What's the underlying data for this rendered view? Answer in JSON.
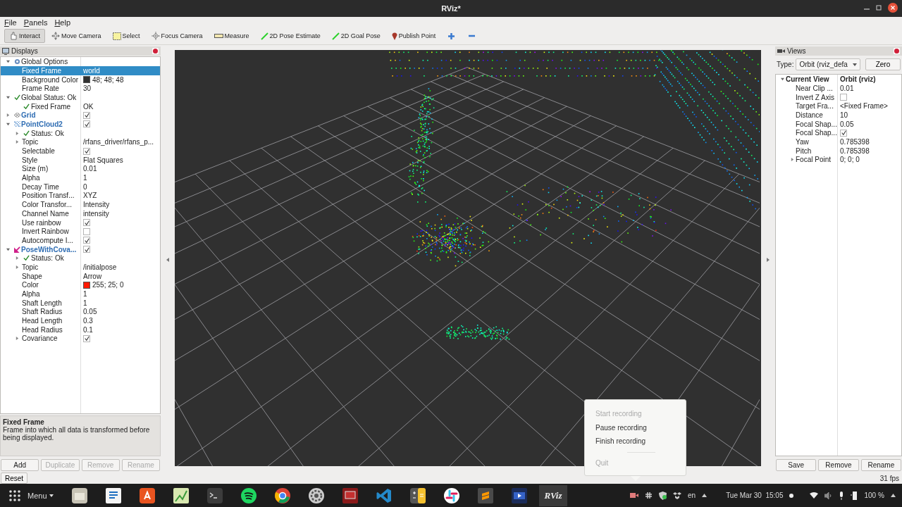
{
  "window": {
    "title": "RViz*"
  },
  "menu": [
    {
      "label": "File"
    },
    {
      "label": "Panels"
    },
    {
      "label": "Help"
    }
  ],
  "toolbar": [
    {
      "kind": "interact",
      "label": "Interact",
      "selected": true
    },
    {
      "kind": "move",
      "label": "Move Camera",
      "selected": false
    },
    {
      "kind": "select",
      "label": "Select",
      "selected": false
    },
    {
      "kind": "focus",
      "label": "Focus Camera",
      "selected": false
    },
    {
      "kind": "measure",
      "label": "Measure",
      "selected": false
    },
    {
      "kind": "pose",
      "label": "2D Pose Estimate",
      "selected": false
    },
    {
      "kind": "pose",
      "label": "2D Goal Pose",
      "selected": false
    },
    {
      "kind": "point",
      "label": "Publish Point",
      "selected": false
    },
    {
      "kind": "add",
      "selected": false
    },
    {
      "kind": "remove",
      "selected": false
    }
  ],
  "displays": {
    "title": "Displays",
    "rows": [
      {
        "kind": "options",
        "label": "Global Options",
        "expanded": true,
        "selected": false,
        "children": [
          {
            "kind": "property",
            "label": "Fixed Frame",
            "value": "world",
            "selected": true
          },
          {
            "kind": "property",
            "label": "Background Color",
            "value": "48; 48; 48",
            "color": "#303030",
            "selected": false
          },
          {
            "kind": "property",
            "label": "Frame Rate",
            "value": "30",
            "selected": false
          }
        ]
      },
      {
        "kind": "status",
        "label": "Global Status: Ok",
        "expanded": true,
        "selected": false,
        "children": [
          {
            "kind": "status",
            "label": "Fixed Frame",
            "value": "OK",
            "selected": false
          }
        ]
      },
      {
        "kind": "grid",
        "label": "Grid",
        "expanded": false,
        "checked": true,
        "selected": false
      },
      {
        "kind": "pointcloud",
        "label": "PointCloud2",
        "expanded": true,
        "checked": true,
        "selected": false,
        "children": [
          {
            "kind": "status",
            "label": "Status: Ok",
            "expanded": false,
            "selected": false
          },
          {
            "kind": "property",
            "label": "Topic",
            "value": "/rfans_driver/rfans_p...",
            "expanded": false,
            "selected": false
          },
          {
            "kind": "property",
            "label": "Selectable",
            "checked": true,
            "selected": false
          },
          {
            "kind": "property",
            "label": "Style",
            "value": "Flat Squares",
            "selected": false
          },
          {
            "kind": "property",
            "label": "Size (m)",
            "value": "0.01",
            "selected": false
          },
          {
            "kind": "property",
            "label": "Alpha",
            "value": "1",
            "selected": false
          },
          {
            "kind": "property",
            "label": "Decay Time",
            "value": "0",
            "selected": false
          },
          {
            "kind": "property",
            "label": "Position Transf...",
            "value": "XYZ",
            "selected": false
          },
          {
            "kind": "property",
            "label": "Color Transfor...",
            "value": "Intensity",
            "selected": false
          },
          {
            "kind": "property",
            "label": "Channel Name",
            "value": "intensity",
            "selected": false
          },
          {
            "kind": "property",
            "label": "Use rainbow",
            "checked": true,
            "selected": false
          },
          {
            "kind": "property",
            "label": "Invert Rainbow",
            "checked": false,
            "selected": false
          },
          {
            "kind": "property",
            "label": "Autocompute I...",
            "checked": true,
            "selected": false
          }
        ]
      },
      {
        "kind": "pose",
        "label": "PoseWithCova...",
        "expanded": true,
        "checked": true,
        "selected": false,
        "children": [
          {
            "kind": "status",
            "label": "Status: Ok",
            "expanded": false,
            "selected": false
          },
          {
            "kind": "property",
            "label": "Topic",
            "value": "/initialpose",
            "expanded": false,
            "selected": false
          },
          {
            "kind": "property",
            "label": "Shape",
            "value": "Arrow",
            "selected": false
          },
          {
            "kind": "property",
            "label": "Color",
            "value": "255; 25; 0",
            "color": "#ff1900",
            "selected": false
          },
          {
            "kind": "property",
            "label": "Alpha",
            "value": "1",
            "selected": false
          },
          {
            "kind": "property",
            "label": "Shaft Length",
            "value": "1",
            "selected": false
          },
          {
            "kind": "property",
            "label": "Shaft Radius",
            "value": "0.05",
            "selected": false
          },
          {
            "kind": "property",
            "label": "Head Length",
            "value": "0.3",
            "selected": false
          },
          {
            "kind": "property",
            "label": "Head Radius",
            "value": "0.1",
            "selected": false
          },
          {
            "kind": "property",
            "label": "Covariance",
            "checked": true,
            "expanded": false,
            "selected": false
          }
        ]
      }
    ]
  },
  "description": {
    "title": "Fixed Frame",
    "text": "Frame into which all data is transformed before being displayed."
  },
  "display_buttons": [
    {
      "label": "Add",
      "disabled": false
    },
    {
      "label": "Duplicate",
      "disabled": true
    },
    {
      "label": "Remove",
      "disabled": true
    },
    {
      "label": "Rename",
      "disabled": true
    }
  ],
  "views": {
    "title": "Views",
    "type_label": "Type:",
    "type_value": "Orbit (rviz_defa",
    "zero": "Zero",
    "rows": [
      {
        "kind": "header",
        "label": "Current View",
        "value": "Orbit (rviz)",
        "expanded": true,
        "children": [
          {
            "label": "Near Clip ...",
            "value": "0.01"
          },
          {
            "label": "Invert Z Axis",
            "checked": false
          },
          {
            "label": "Target Fra...",
            "value": "<Fixed Frame>"
          },
          {
            "label": "Distance",
            "value": "10"
          },
          {
            "label": "Focal Shap...",
            "value": "0.05"
          },
          {
            "label": "Focal Shap...",
            "checked": true
          },
          {
            "label": "Yaw",
            "value": "0.785398"
          },
          {
            "label": "Pitch",
            "value": "0.785398"
          },
          {
            "label": "Focal Point",
            "value": "0; 0; 0",
            "expanded": false
          }
        ]
      }
    ],
    "buttons": [
      {
        "label": "Save"
      },
      {
        "label": "Remove"
      },
      {
        "label": "Rename"
      }
    ]
  },
  "status_bar": {
    "reset": "Reset",
    "fps": "31 fps"
  },
  "recorder_menu": {
    "items": [
      {
        "kind": "item",
        "label": "Start recording",
        "disabled": true
      },
      {
        "kind": "item",
        "label": "Pause recording",
        "disabled": false
      },
      {
        "kind": "item",
        "label": "Finish recording",
        "disabled": false
      },
      {
        "kind": "separator"
      },
      {
        "kind": "item",
        "label": "Quit",
        "disabled": true
      }
    ]
  },
  "taskbar": {
    "menu_label": "Menu",
    "apps": [
      {
        "kind": "files"
      },
      {
        "kind": "writer"
      },
      {
        "kind": "store"
      },
      {
        "kind": "editor"
      },
      {
        "kind": "terminal"
      },
      {
        "kind": "spotify"
      },
      {
        "kind": "chrome"
      },
      {
        "kind": "settings"
      },
      {
        "kind": "remmina"
      },
      {
        "kind": "vscode"
      },
      {
        "kind": "calculator"
      },
      {
        "kind": "slack"
      },
      {
        "kind": "sublime"
      },
      {
        "kind": "video"
      },
      {
        "kind": "rviz",
        "label": "RViz"
      }
    ],
    "tray": {
      "language": "en",
      "clock": "Tue Mar 30  15:05",
      "battery": "100 %"
    }
  }
}
